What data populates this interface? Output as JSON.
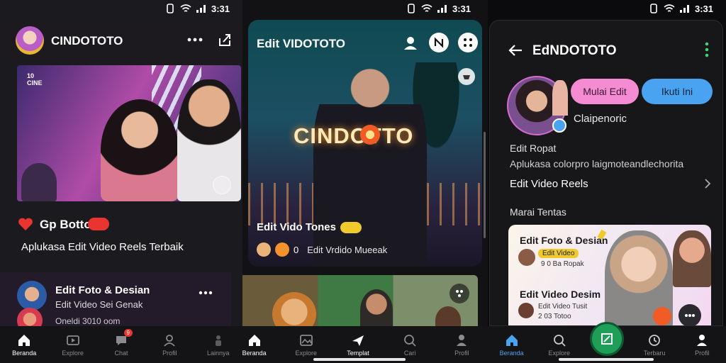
{
  "status": {
    "left_time": "3:31",
    "mid_time": "3:31",
    "right_time": "3:31"
  },
  "left": {
    "app_title": "CINDOTOTO",
    "hero_badge_1": "10",
    "hero_badge_2": "CINE",
    "post_title": "Gp Botto",
    "post_badge": "",
    "post_desc": "Aplukasa Edit Video Reels Terbaik",
    "card_title": "Edit Foto & Desian",
    "card_sub": "Edit Video Sei Genak",
    "card_meta": "Oneldi 3010 oom",
    "nav": [
      {
        "label": "Beranda"
      },
      {
        "label": "Explore"
      },
      {
        "label": "Chat",
        "badge": "9"
      },
      {
        "label": "Profil"
      },
      {
        "label": "Lainnya"
      }
    ]
  },
  "middle": {
    "title": "Edit VIDOTOTO",
    "brand_text": "CINDOTTO",
    "caption_title": "Edit Vido Tones",
    "caption_sub": "Edit Vrdido Mueeak",
    "caption_num": "0",
    "nav": [
      {
        "label": "Beranda"
      },
      {
        "label": "Explore"
      },
      {
        "label": "Templat"
      },
      {
        "label": "Cari"
      },
      {
        "label": "Profil"
      }
    ]
  },
  "right": {
    "title": "EdNDOTOTO",
    "btn_primary": "Mulai Edit",
    "btn_secondary": "Ikuti Ini",
    "profile_handle": "Claipenoric",
    "section_label": "Edit Ropat",
    "section_desc": "Aplukasa colorpro laigmoteandlechorita",
    "link_label": "Edit Video Reels",
    "list_heading": "Marai Tentas",
    "card1_title": "Edit Foto & Desian",
    "card1_tag": "Edit Video",
    "card1_meta": "9 0 Ba Ropak",
    "card2_title": "Edit Video Desim",
    "card2_meta1": "Edit Video Tusit",
    "card2_meta2": "2 03 Totoo",
    "nav": [
      {
        "label": "Beranda"
      },
      {
        "label": "Explore"
      },
      {
        "label": ""
      },
      {
        "label": "Terbaru"
      },
      {
        "label": "Profil"
      }
    ]
  },
  "colors": {
    "accent_red": "#e9342f",
    "accent_pink": "#f58bd3",
    "accent_blue": "#4aa3f0",
    "accent_green": "#1f9e58",
    "accent_orange": "#f0942b"
  }
}
